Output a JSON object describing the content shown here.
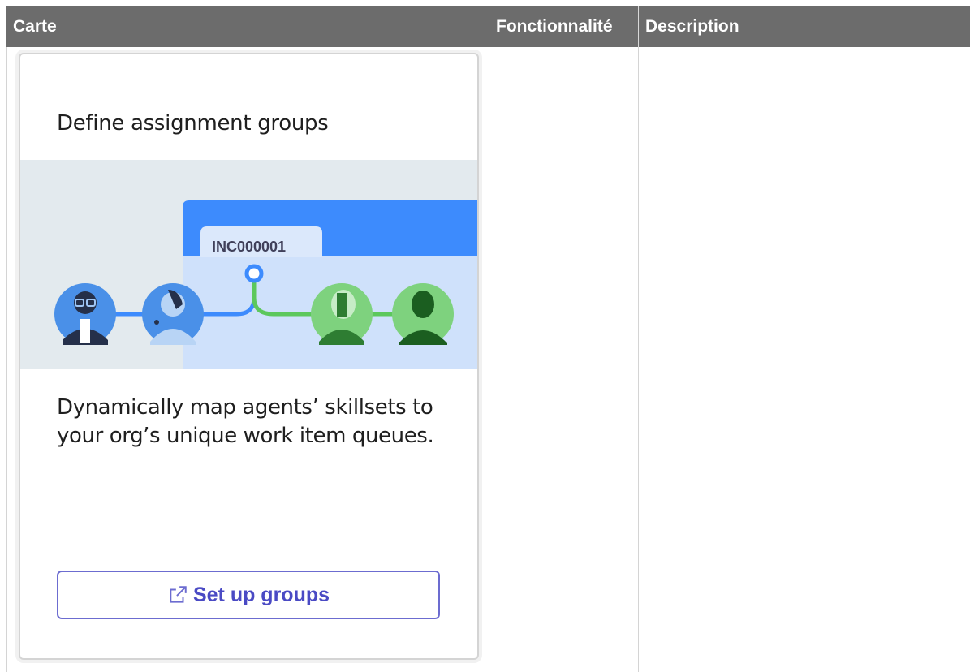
{
  "table": {
    "headers": [
      "Carte",
      "Fonctionnalité",
      "Description"
    ]
  },
  "card": {
    "title": "Define assignment groups",
    "ticket_label": "INC000001",
    "description": "Dynamically map agents’ skillsets to your org’s unique work item queues.",
    "button_label": "Set up groups",
    "button_icon": "external-link-icon"
  },
  "colors": {
    "header_bg": "#6c6c6c",
    "hero_bg": "#e3eaee",
    "ticket_blue": "#3d8bfd",
    "ticket_panel": "#cfe1fb",
    "connector_blue": "#3d8bfd",
    "connector_green": "#5cc85c",
    "button_accent": "#4a4ac4"
  }
}
